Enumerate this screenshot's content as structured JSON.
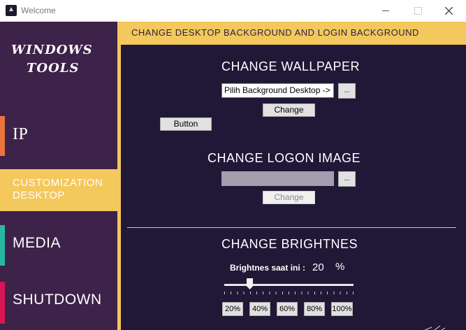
{
  "window": {
    "title": "Welcome"
  },
  "sidebar": {
    "brand_line1": "WINDOWS",
    "brand_line2": "TOOLS",
    "items": [
      {
        "label": "IP",
        "accent": "#e9753a"
      },
      {
        "label": "CUSTOMIZATION DESKTOP",
        "active": true
      },
      {
        "label": "MEDIA",
        "accent": "#27b9a0"
      },
      {
        "label": "SHUTDOWN",
        "accent": "#d81553"
      }
    ]
  },
  "header": {
    "title": "CHANGE DESKTOP BACKGROUND AND LOGIN BACKGROUND"
  },
  "wallpaper": {
    "title": "CHANGE WALLPAPER",
    "path_value": "Pilih Background Desktop ->",
    "browse_label": "...",
    "change_label": "Change"
  },
  "generic_button": {
    "label": "Button"
  },
  "logon": {
    "title": "CHANGE LOGON IMAGE",
    "path_value": "",
    "browse_label": "...",
    "change_label": "Change"
  },
  "brightness": {
    "title": "CHANGE BRIGHTNES",
    "label": "Brightnes saat ini :",
    "value": "20",
    "unit": "%",
    "slider_level": 0.2,
    "presets": [
      "20%",
      "40%",
      "60%",
      "80%",
      "100%"
    ]
  },
  "colors": {
    "sidebar_bg": "#3d2249",
    "accent_yellow": "#f3c85d",
    "main_bg": "#201836"
  },
  "icons": {
    "app": "app-logo-icon",
    "minimize": "minimize-icon",
    "maximize": "maximize-icon",
    "close": "close-icon"
  }
}
